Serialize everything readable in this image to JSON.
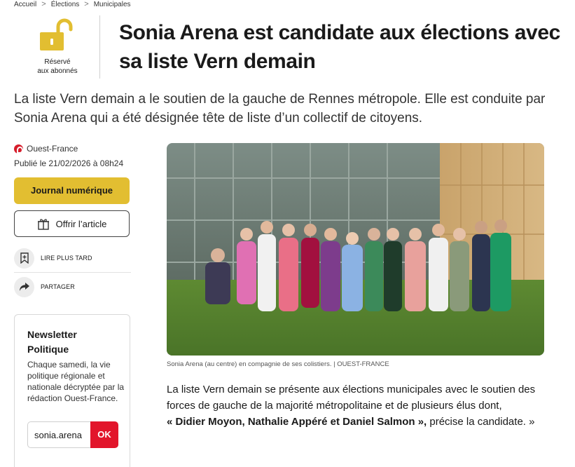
{
  "breadcrumb": {
    "items": [
      "Accueil",
      "Élections",
      "Municipales"
    ],
    "separator": ">"
  },
  "badge": {
    "icon": "open-padlock-icon",
    "line1": "Réservé",
    "line2": "aux abonnés",
    "color": "#e2be31"
  },
  "article": {
    "title": "Sonia Arena est candidate aux élections avec sa liste Vern demain",
    "lead": "La liste Vern demain a le soutien de la gauche de Rennes métropole. Elle est conduite par Sonia Arena qui a été désignée tête de liste d’un collectif de citoyens.",
    "source": "Ouest-France",
    "published": "Publié le 21/02/2026 à 08h24",
    "photo_caption": "Sonia Arena (au centre) en compagnie de ses colistiers. | OUEST-FRANCE",
    "body_part1": "La liste Vern demain se présente aux élections municipales avec le soutien des forces de gauche de la majorité métropolitaine et de plusieurs élus dont,",
    "body_bold": "« Didier Moyon, Nathalie Appéré et Daniel Salmon »,",
    "body_part2": " précise la candidate. »"
  },
  "actions": {
    "journal_label": "Journal numérique",
    "offrir_label": "Offrir l’article",
    "read_later_label": "LIRE PLUS TARD",
    "share_label": "PARTAGER"
  },
  "newsletter": {
    "title": "Newsletter Politique",
    "description": "Chaque samedi, la vie politique régionale et nationale décryptée par la rédaction Ouest-France.",
    "input_value": "sonia.arena",
    "submit_label": "OK"
  },
  "colors": {
    "accent_yellow": "#e2be31",
    "brand_red": "#d61d2b",
    "ok_red": "#e2152b"
  }
}
